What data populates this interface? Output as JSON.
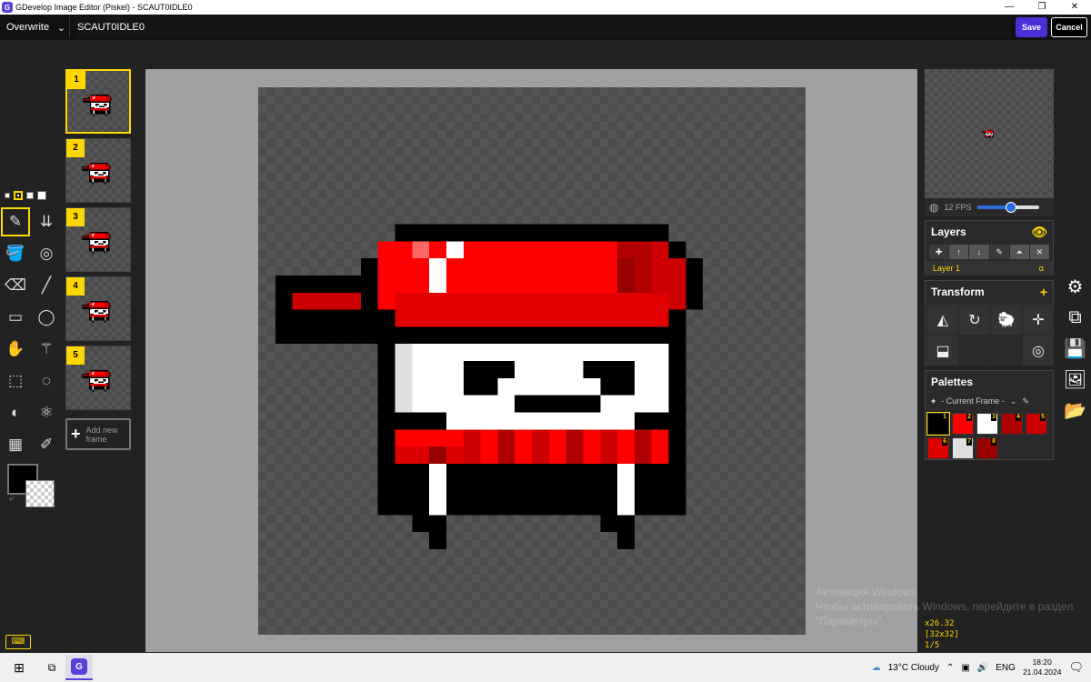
{
  "window": {
    "title": "GDevelop Image Editor (Piskel) - SCAUT0IDLE0",
    "minimize": "—",
    "restore": "❐",
    "close": "✕"
  },
  "topbar": {
    "mode": "Overwrite",
    "filename": "SCAUT0IDLE0",
    "save_label": "Save",
    "cancel_label": "Cancel"
  },
  "frames": [
    {
      "num": "1"
    },
    {
      "num": "2"
    },
    {
      "num": "3"
    },
    {
      "num": "4"
    },
    {
      "num": "5"
    }
  ],
  "add_frame_label": "Add new frame",
  "preview": {
    "fps_label": "12 FPS",
    "fps_fraction": 0.55
  },
  "layers": {
    "title": "Layers",
    "layer_name": "Layer 1",
    "alpha_label": "α"
  },
  "transform": {
    "title": "Transform"
  },
  "palettes": {
    "title": "Palettes",
    "selected": "- Current Frame -",
    "colors": [
      {
        "num": "1",
        "color": "#000000"
      },
      {
        "num": "2",
        "color": "#ff0000"
      },
      {
        "num": "3",
        "color": "#ffffff"
      },
      {
        "num": "4",
        "color": "#b00000"
      },
      {
        "num": "5",
        "color": "#cc0000"
      },
      {
        "num": "6",
        "color": "#dd0000"
      },
      {
        "num": "7",
        "color": "#e0e0e0"
      },
      {
        "num": "8",
        "color": "#990000"
      }
    ]
  },
  "status": {
    "cursor": "x26.32",
    "size": "[32x32]",
    "frame": "1/5"
  },
  "watermark": {
    "line1": "Активация Windows",
    "line2": "Чтобы активировать Windows, перейдите в раздел",
    "line3": "\"Параметры\"."
  },
  "taskbar": {
    "weather": "13°C  Cloudy",
    "lang": "ENG",
    "time": "18:20",
    "date": "21.04.2024"
  },
  "colors": {
    "accent": "#ffd700",
    "save_button": "#4a2fd6",
    "primary": "#000000"
  }
}
